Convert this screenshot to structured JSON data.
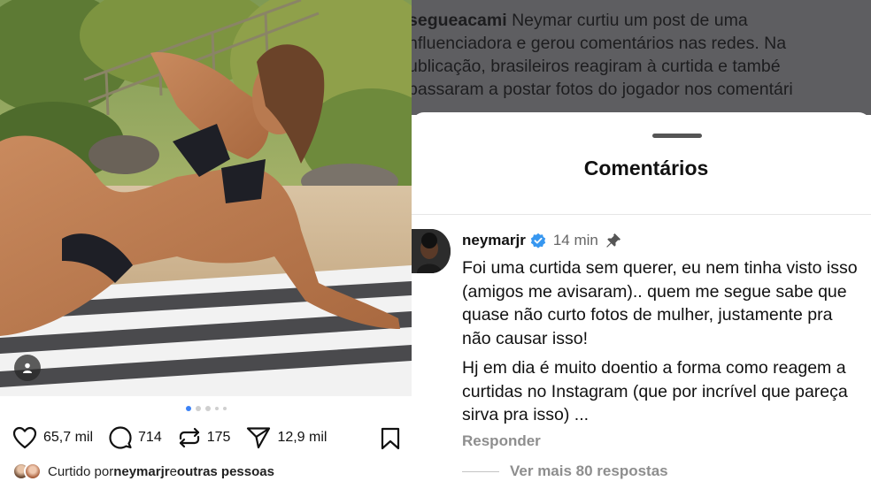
{
  "post": {
    "likes": "65,7 mil",
    "comments": "714",
    "reposts": "175",
    "shares": "12,9 mil",
    "carousel_total": 5,
    "carousel_active": 1,
    "liked_by_prefix": "Curtido por ",
    "liked_by_user": "neymarjr",
    "liked_by_joiner": " e ",
    "liked_by_others": "outras pessoas",
    "caption_cut": "..."
  },
  "overlay": {
    "account": "segueacami",
    "lines": [
      " Neymar curtiu um post de uma",
      "nfluenciadora e gerou comentários nas redes. Na",
      "ublicação, brasileiros reagiram à curtida e també",
      "passaram a postar fotos do jogador nos comentári"
    ]
  },
  "comments_sheet": {
    "title": "Comentários",
    "comment": {
      "username": "neymarjr",
      "time": "14 min",
      "paragraphs": [
        "Foi uma curtida sem querer, eu nem tinha visto isso (amigos me avisaram).. quem me segue sabe que quase não curto fotos de mulher, justamente pra não causar isso!",
        "Hj em dia é muito doentio a forma como reagem a curtidas no Instagram (que por incrível que pareça sirva pra isso) ..."
      ],
      "reply_label": "Responder",
      "view_replies_label": "Ver mais 80 respostas"
    }
  },
  "icons": {
    "like": "heart-icon",
    "comment": "comment-bubble-icon",
    "repost": "repost-icon",
    "share": "send-icon",
    "save": "bookmark-icon",
    "verified": "verified-badge-icon",
    "pinned": "pin-icon",
    "tagged_user": "user-tag-icon"
  },
  "colors": {
    "verified": "#3797f0",
    "carousel_active": "#3b82f6",
    "overlay_bg": "#5e5e61",
    "secondary_text": "#8e8e8e"
  }
}
